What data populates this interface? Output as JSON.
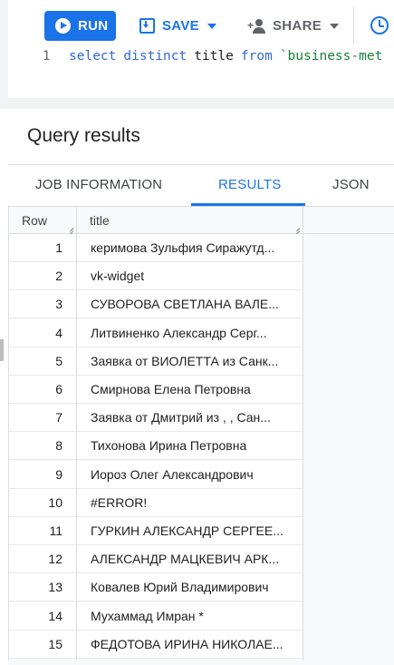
{
  "toolbar": {
    "run_label": "RUN",
    "save_label": "SAVE",
    "share_label": "SHARE"
  },
  "editor": {
    "line_number": "1",
    "code": {
      "select": "select",
      "distinct": "distinct",
      "field": "title",
      "from": "from",
      "table": "`business-met"
    }
  },
  "results": {
    "title": "Query results",
    "tabs": [
      "JOB INFORMATION",
      "RESULTS",
      "JSON"
    ],
    "active_tab": "RESULTS",
    "columns": [
      "Row",
      "title"
    ],
    "rows": [
      {
        "row": "1",
        "title": "керимова Зульфия Сиражутд..."
      },
      {
        "row": "2",
        "title": "vk-widget"
      },
      {
        "row": "3",
        "title": "СУВОРОВА СВЕТЛАНА ВАЛЕ..."
      },
      {
        "row": "4",
        "title": "Литвиненко Александр Серг..."
      },
      {
        "row": "5",
        "title": "Заявка от ВИОЛЕТТА из Санк..."
      },
      {
        "row": "6",
        "title": "Смирнова Елена Петровна"
      },
      {
        "row": "7",
        "title": "Заявка от Дмитрий из , , Сан..."
      },
      {
        "row": "8",
        "title": "Тихонова Ирина Петровна"
      },
      {
        "row": "9",
        "title": "Иороз Олег Александрович"
      },
      {
        "row": "10",
        "title": "#ERROR!"
      },
      {
        "row": "11",
        "title": "ГУРКИН АЛЕКСАНДР СЕРГЕЕ..."
      },
      {
        "row": "12",
        "title": "АЛЕКСАНДР МАЦКЕВИЧ АРК..."
      },
      {
        "row": "13",
        "title": "Ковалев Юрий Владимирович"
      },
      {
        "row": "14",
        "title": "Мухаммад Имран *"
      },
      {
        "row": "15",
        "title": "ФЕДОТОВА ИРИНА НИКОЛАЕ..."
      }
    ]
  },
  "colors": {
    "accent": "#1a73e8",
    "keyword": "#3367d6",
    "string": "#188038"
  },
  "icons": [
    "play-circle-icon",
    "save-icon",
    "add-person-icon",
    "clock-icon"
  ]
}
